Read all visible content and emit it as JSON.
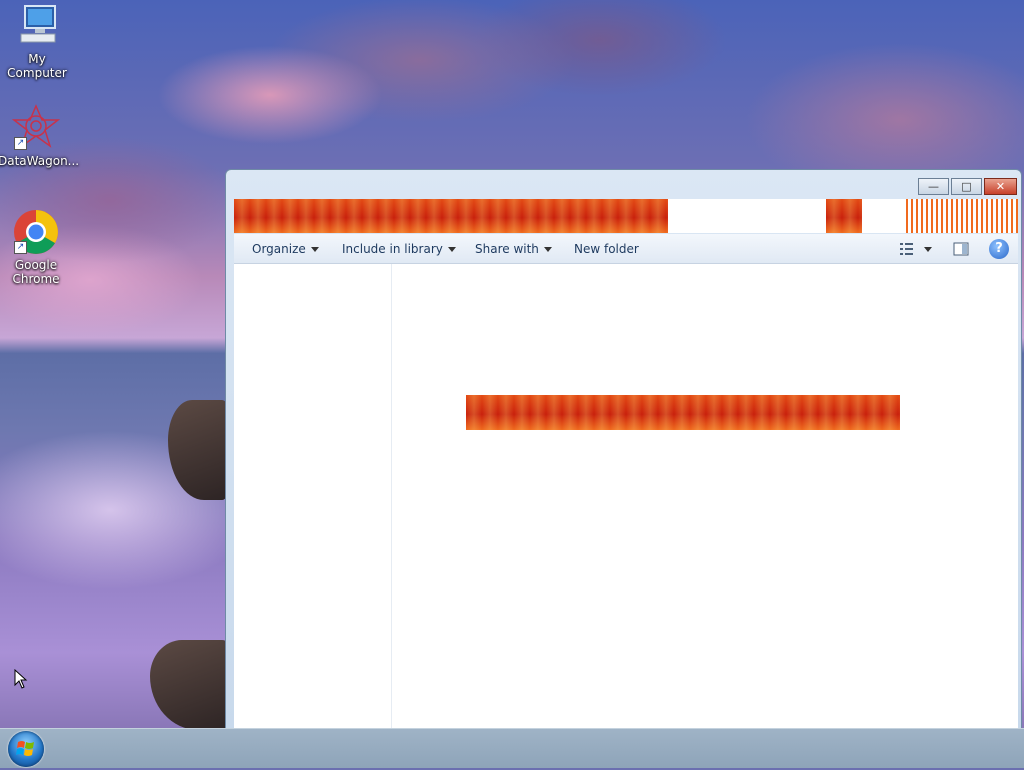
{
  "desktop": {
    "icons": [
      {
        "label": "My Computer",
        "icon": "computer-icon"
      },
      {
        "label": "DataWagon...",
        "icon": "datawagon-icon"
      },
      {
        "label": "Google Chrome",
        "icon": "chrome-icon"
      }
    ]
  },
  "window": {
    "caption_buttons": {
      "minimize": "—",
      "maximize": "□",
      "close": "✕"
    },
    "toolbar": {
      "organize": "Organize",
      "include_in_library": "Include in library",
      "share_with": "Share with",
      "new_folder": "New folder",
      "views_icon": "views-icon",
      "preview_pane_icon": "preview-pane-icon",
      "help_icon": "help-icon",
      "help_symbol": "?"
    }
  },
  "colors": {
    "glitch_red": "#d9300f",
    "toolbar_text": "#1e3a5f",
    "window_frame": "#c8d9ec"
  }
}
